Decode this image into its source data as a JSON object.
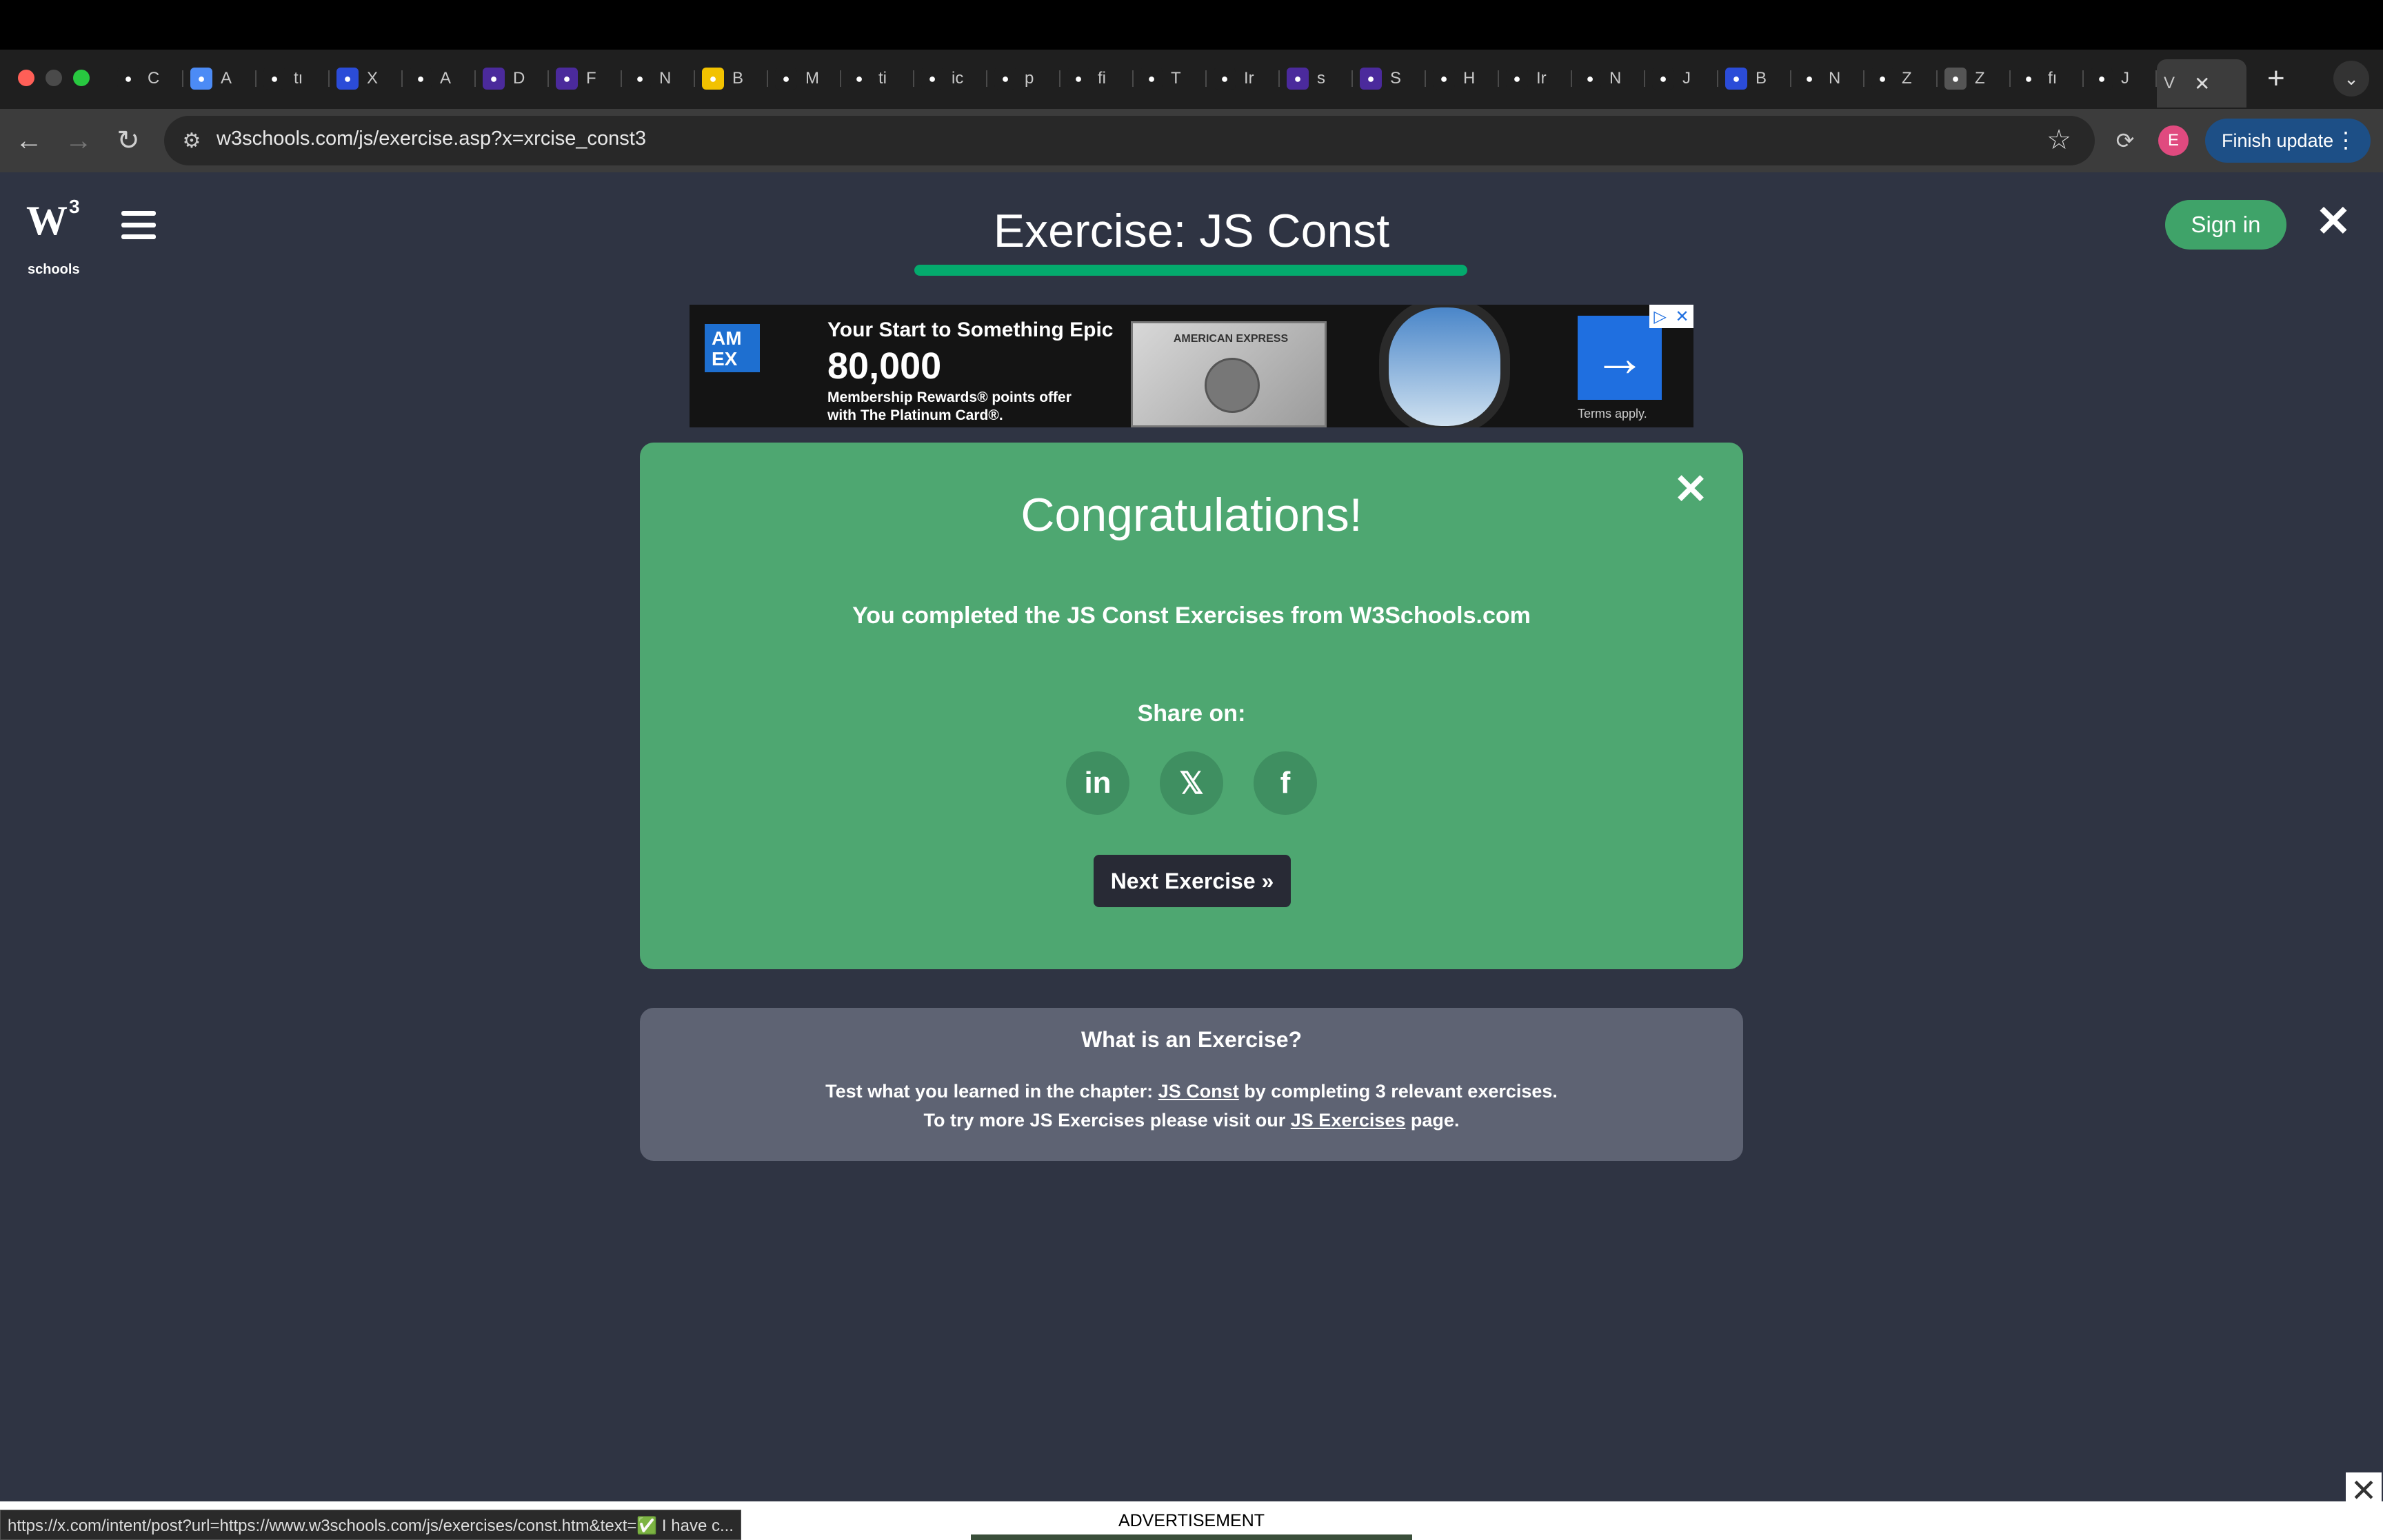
{
  "browser": {
    "tabs": [
      {
        "label": "C",
        "icon": "gmail-icon",
        "color": "#1f1f1f"
      },
      {
        "label": "A",
        "icon": "docs-icon",
        "color": "#4c8bf5"
      },
      {
        "label": "tı",
        "icon": "google-icon",
        "color": "#1f1f1f"
      },
      {
        "label": "X",
        "icon": "t-icon",
        "color": "#2b4cd8"
      },
      {
        "label": "A",
        "icon": "google-icon",
        "color": "#1f1f1f"
      },
      {
        "label": "D",
        "icon": "pin-icon",
        "color": "#4b2a9c"
      },
      {
        "label": "F",
        "icon": "pin-icon",
        "color": "#4b2a9c"
      },
      {
        "label": "N",
        "icon": "chatgpt-icon",
        "color": "#1f1f1f"
      },
      {
        "label": "B",
        "icon": "i-icon",
        "color": "#f2c200"
      },
      {
        "label": "M",
        "icon": "v-icon",
        "color": "#1f1f1f"
      },
      {
        "label": "ti",
        "icon": "globe-icon",
        "color": "#1f1f1f"
      },
      {
        "label": "ic",
        "icon": "globe-icon",
        "color": "#1f1f1f"
      },
      {
        "label": "p",
        "icon": "google-icon",
        "color": "#1f1f1f"
      },
      {
        "label": "fi",
        "icon": "google-icon",
        "color": "#1f1f1f"
      },
      {
        "label": "T",
        "icon": "bank-icon",
        "color": "#1f1f1f"
      },
      {
        "label": "Ir",
        "icon": "bank-icon",
        "color": "#1f1f1f"
      },
      {
        "label": "s",
        "icon": "pin-icon",
        "color": "#4b2a9c"
      },
      {
        "label": "S",
        "icon": "pin-icon",
        "color": "#4b2a9c"
      },
      {
        "label": "H",
        "icon": "globe-icon",
        "color": "#1f1f1f"
      },
      {
        "label": "Ir",
        "icon": "github-icon",
        "color": "#1f1f1f"
      },
      {
        "label": "N",
        "icon": "globe-icon",
        "color": "#1f1f1f"
      },
      {
        "label": "J",
        "icon": "w3-icon",
        "color": "#1f1f1f"
      },
      {
        "label": "B",
        "icon": "st-icon",
        "color": "#2b4cd8"
      },
      {
        "label": "N",
        "icon": "chatgpt-icon",
        "color": "#1f1f1f"
      },
      {
        "label": "Z",
        "icon": "google-icon",
        "color": "#1f1f1f"
      },
      {
        "label": "Z",
        "icon": "z-icon",
        "color": "#555555"
      },
      {
        "label": "fı",
        "icon": "google-icon",
        "color": "#1f1f1f"
      },
      {
        "label": "J",
        "icon": "w3-icon",
        "color": "#1f1f1f"
      }
    ],
    "active_tab_label": "V",
    "url": "w3schools.com/js/exercise.asp?x=xrcise_const3",
    "profile_initial": "E",
    "finish_update_label": "Finish update",
    "status_url": "https://x.com/intent/post?url=https://www.w3schools.com/js/exercises/const.htm&text=✅ I have c..."
  },
  "header": {
    "logo_text": "W",
    "logo_sup": "3",
    "logo_sub": "schools",
    "title": "Exercise: JS Const",
    "progress": 1.0,
    "signin_label": "Sign in"
  },
  "ad": {
    "logo": "AM EX",
    "headline": "Your Start to Something Epic",
    "points": "80,000",
    "fine_print": "Membership Rewards® points offer with The Platinum Card®.",
    "card_label": "AMERICAN EXPRESS",
    "terms": "Terms apply."
  },
  "congrats": {
    "title": "Congratulations!",
    "message": "You completed the JS Const Exercises from W3Schools.com",
    "share_label": "Share on:",
    "share": {
      "linkedin": "in",
      "x": "𝕏",
      "facebook": "f"
    },
    "next_label": "Next Exercise »"
  },
  "info": {
    "title": "What is an Exercise?",
    "line1_pre": "Test what you learned in the chapter: ",
    "line1_link": "JS Const",
    "line1_post": " by completing 3 relevant exercises.",
    "line2_pre": "To try more JS Exercises please visit our ",
    "line2_link": "JS Exercises",
    "line2_post": " page."
  },
  "bottom": {
    "ad_label": "ADVERTISEMENT"
  },
  "colors": {
    "page_bg": "#2f3443",
    "success": "#4ea771",
    "progress": "#04aa6d",
    "signin": "#3fa369",
    "info_bg": "#5e6373"
  }
}
